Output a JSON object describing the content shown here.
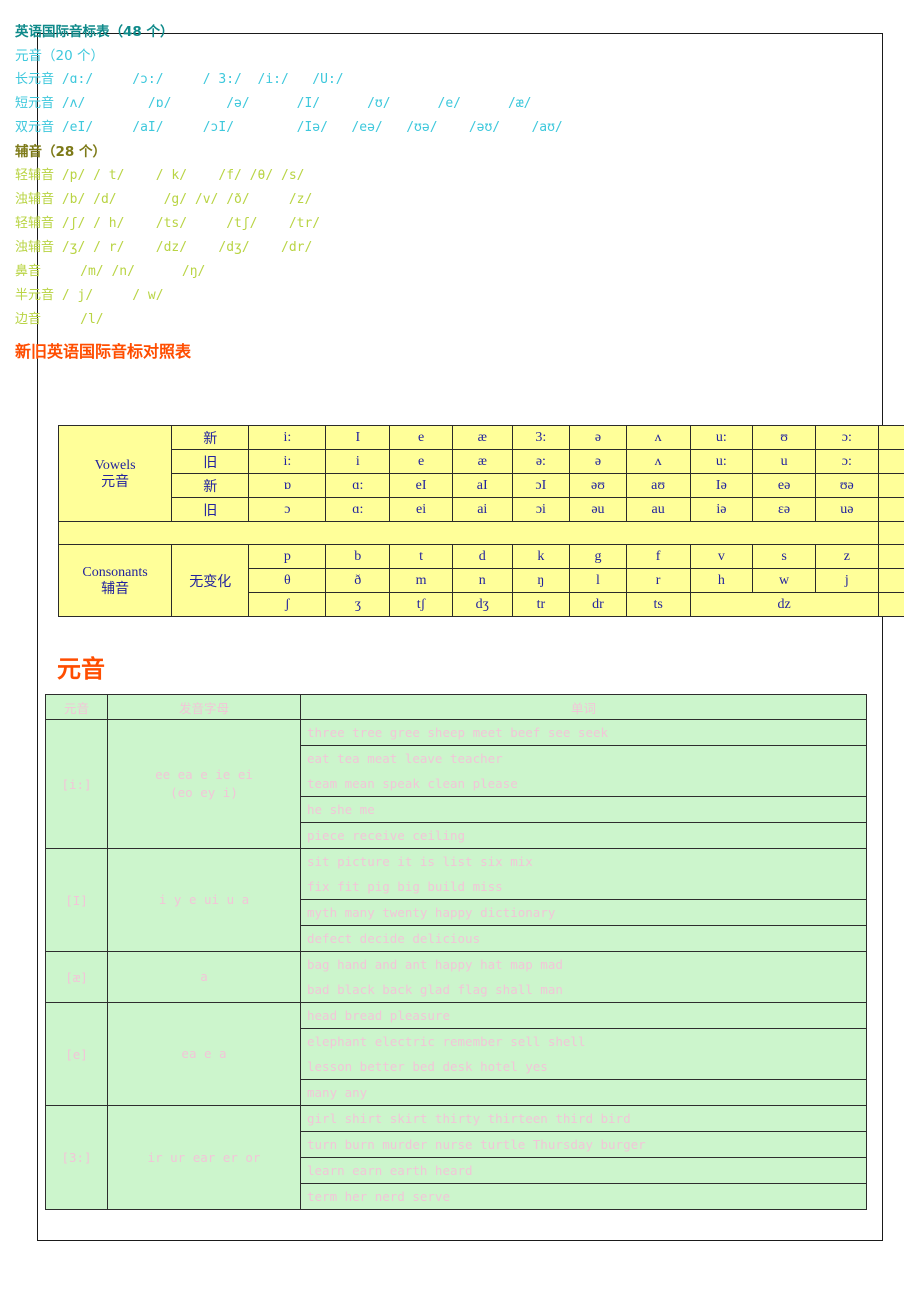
{
  "ipa": {
    "title": "英语国际音标表（48 个）",
    "vowels_heading": "元音（20 个）",
    "consonants_heading": "辅音（28 个）",
    "vowel_lines": [
      {
        "label": "长元音",
        "symbols": " /ɑ:/     /ɔ:/     / 3:/  /i:/   /U:/"
      },
      {
        "label": "短元音",
        "symbols": " /ʌ/        /ɒ/       /ə/      /I/      /ʊ/      /e/      /æ/"
      },
      {
        "label": "双元音",
        "symbols": " /eI/     /aI/     /ɔI/        /Iə/   /eə/   /ʊə/    /əʊ/    /aʊ/"
      }
    ],
    "consonant_lines": [
      {
        "label": "轻辅音",
        "symbols": " /p/ / t/    / k/    /f/ /θ/ /s/"
      },
      {
        "label": "浊辅音",
        "symbols": " /b/ /d/      /g/ /v/ /ð/     /z/"
      },
      {
        "label": "轻辅音",
        "symbols": " /ʃ/ / h/    /ts/     /tʃ/    /tr/"
      },
      {
        "label": "浊辅音",
        "symbols": " /ʒ/ / r/    /dz/    /dʒ/    /dr/"
      },
      {
        "label": "鼻音",
        "symbols": "     /m/ /n/      /ŋ/"
      },
      {
        "label": "半元音",
        "symbols": " / j/     / w/"
      },
      {
        "label": "边音",
        "symbols": "     /l/"
      }
    ]
  },
  "comparison": {
    "title": "新旧英语国际音标对照表",
    "vowels_label_en": "Vowels",
    "vowels_label_cn": "元音",
    "consonants_label_en": "Consonants",
    "consonants_label_cn": "辅音",
    "new_label": "新",
    "old_label": "旧",
    "no_change_label": "无变化",
    "vowel_rows": [
      {
        "kind": "新",
        "cells": [
          "i:",
          "I",
          "e",
          "æ",
          "3:",
          "ə",
          "ʌ",
          "u:",
          "ʊ",
          "ɔ:"
        ]
      },
      {
        "kind": "旧",
        "cells": [
          "i:",
          "i",
          "e",
          "æ",
          "ə:",
          "ə",
          "ʌ",
          "u:",
          "u",
          "ɔ:"
        ]
      },
      {
        "kind": "新",
        "cells": [
          "ɒ",
          "ɑ:",
          "eI",
          "aI",
          "ɔI",
          "əʊ",
          "aʊ",
          "Iə",
          "eə",
          "ʊə"
        ]
      },
      {
        "kind": "旧",
        "cells": [
          "ɔ",
          "ɑ:",
          "ei",
          "ai",
          "ɔi",
          "əu",
          "au",
          "iə",
          "ɛə",
          "uə"
        ]
      }
    ],
    "consonant_rows": [
      [
        "p",
        "b",
        "t",
        "d",
        "k",
        "g",
        "f",
        "v",
        "s",
        "z"
      ],
      [
        "θ",
        "ð",
        "m",
        "n",
        "ŋ",
        "l",
        "r",
        "h",
        "w",
        "j"
      ],
      [
        "ʃ",
        "ʒ",
        "tʃ",
        "dʒ",
        "tr",
        "dr",
        "ts",
        "dz"
      ]
    ]
  },
  "vowel_section": {
    "title": "元音",
    "headers": [
      "元音",
      "发音字母",
      "单词"
    ],
    "rows": [
      {
        "symbol": "[i:]",
        "letters": "ee ea e ie ei\n(eo ey i)",
        "groups": [
          [
            "three tree gree sheep meet beef see seek"
          ],
          [
            "eat tea meat leave teacher",
            "team mean speak clean please"
          ],
          [
            "he she me"
          ],
          [
            "piece receive ceiling"
          ]
        ]
      },
      {
        "symbol": "[I]",
        "letters": "i y e ui u a",
        "groups": [
          [
            "sit picture it is list six mix",
            "fix fit pig big build miss"
          ],
          [
            "myth many twenty happy dictionary"
          ],
          [
            "defect decide delicious"
          ]
        ]
      },
      {
        "symbol": "[æ]",
        "letters": "a",
        "groups": [
          [
            "bag hand and ant happy hat map mad",
            "bad black back glad flag shall man"
          ]
        ]
      },
      {
        "symbol": "[e]",
        "letters": "ea e a",
        "groups": [
          [
            "head bread pleasure"
          ],
          [
            "elephant electric remember sell shell",
            "lesson better bed desk hotel yes"
          ],
          [
            "many any"
          ]
        ]
      },
      {
        "symbol": "[3:]",
        "letters": "ir ur ear er or",
        "groups": [
          [
            "girl shirt skirt thirty thirteen third bird"
          ],
          [
            "turn burn murder nurse turtle Thursday burger"
          ],
          [
            "learn earn earth heard"
          ],
          [
            "term her nerd serve"
          ]
        ]
      }
    ]
  },
  "colors": {
    "teal": "#0f8a8a",
    "cyan": "#3ec8dc",
    "olive": "#7d7a18",
    "yellowgreen": "#b9d444",
    "orange": "#ff4d00",
    "table_yellow": "#ffff99",
    "table_green": "#ccf5cc",
    "ink_blue": "#23239e",
    "pink": "#f2c5d8"
  }
}
